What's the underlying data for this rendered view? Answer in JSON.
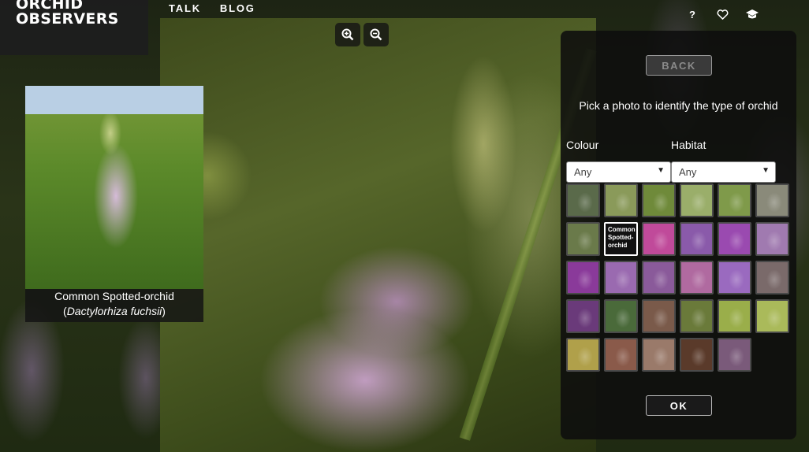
{
  "brand": {
    "logo_line1": "ORCHID",
    "logo_line2": "OBSERVERS"
  },
  "nav": {
    "talk": "TALK",
    "blog": "BLOG"
  },
  "top_icons": {
    "help": "?",
    "help_icon": "question-icon",
    "favorites_icon": "heart-icon",
    "education_icon": "graduation-cap-icon"
  },
  "zoom": {
    "in_icon": "zoom-in-icon",
    "out_icon": "zoom-out-icon"
  },
  "species": {
    "common_name": "Common Spotted-orchid",
    "latin_name": "Dactylorhiza fuchsii",
    "paren_open": "(",
    "paren_close": ")"
  },
  "panel": {
    "back_label": "BACK",
    "instruction": "Pick a photo to identify the type of orchid",
    "colour_label": "Colour",
    "habitat_label": "Habitat",
    "colour_value": "Any",
    "habitat_value": "Any",
    "ok_label": "OK"
  },
  "thumbnails": [
    {
      "color": "#5a6a4a"
    },
    {
      "color": "#8a9a5a"
    },
    {
      "color": "#6f8a3a"
    },
    {
      "color": "#9aae6a"
    },
    {
      "color": "#7f9a4a"
    },
    {
      "color": "#8a8a7a"
    },
    {
      "color": "#6a7a4a"
    },
    {
      "label": "Common Spotted-orchid",
      "selected": true,
      "color": "#111111"
    },
    {
      "color": "#c04a9a"
    },
    {
      "color": "#8a5aaa"
    },
    {
      "color": "#9a4ab0"
    },
    {
      "color": "#a07ab0"
    },
    {
      "color": "#8a3a9a"
    },
    {
      "color": "#9a6ab0"
    },
    {
      "color": "#8a5a9a"
    },
    {
      "color": "#b06aa0"
    },
    {
      "color": "#9a6abf"
    },
    {
      "color": "#7a6a6a"
    },
    {
      "color": "#6a3a7a"
    },
    {
      "color": "#4a6a3a"
    },
    {
      "color": "#7a5a4a"
    },
    {
      "color": "#6a7a3a"
    },
    {
      "color": "#9aae4a"
    },
    {
      "color": "#aaba5a"
    },
    {
      "color": "#b0a04a"
    },
    {
      "color": "#8a5a4a"
    },
    {
      "color": "#9a7a6a"
    },
    {
      "color": "#5a3a2a"
    },
    {
      "color": "#7a5a7a"
    }
  ]
}
